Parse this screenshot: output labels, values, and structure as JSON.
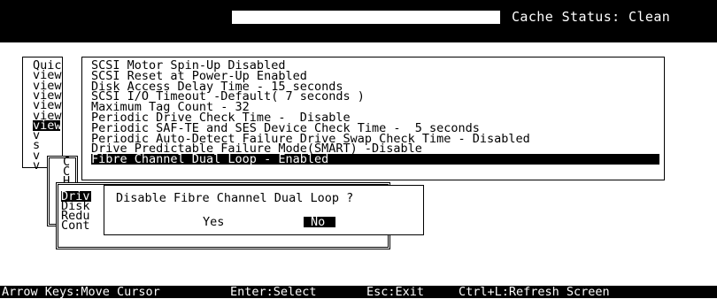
{
  "header": {
    "cache_status": "Cache Status: Clean"
  },
  "main_menu": {
    "items": [
      {
        "label": "Quic",
        "selected": false
      },
      {
        "label": "view",
        "selected": false
      },
      {
        "label": "view",
        "selected": false
      },
      {
        "label": "view",
        "selected": false
      },
      {
        "label": "view",
        "selected": false
      },
      {
        "label": "view",
        "selected": false
      },
      {
        "label": "view",
        "selected": true
      },
      {
        "label": "v",
        "selected": false
      },
      {
        "label": "s",
        "selected": false
      },
      {
        "label": "v",
        "selected": false
      },
      {
        "label": "v",
        "selected": false
      }
    ]
  },
  "submenu_level2": {
    "items": [
      "C",
      "C",
      "H"
    ]
  },
  "submenu_level3": {
    "items": [
      {
        "label": "Driv",
        "selected": true
      },
      {
        "label": "Disk",
        "selected": false
      },
      {
        "label": "Redu",
        "selected": false
      },
      {
        "label": "Cont",
        "selected": false
      }
    ]
  },
  "options_list": {
    "items": [
      {
        "label": "SCSI Motor Spin-Up Disabled",
        "selected": false
      },
      {
        "label": "SCSI Reset at Power-Up Enabled",
        "selected": false
      },
      {
        "label": "Disk Access Delay Time - 15 seconds",
        "selected": false
      },
      {
        "label": "SCSI I/O Timeout -Default( 7 seconds )",
        "selected": false
      },
      {
        "label": "Maximum Tag Count - 32",
        "selected": false
      },
      {
        "label": "Periodic Drive Check Time -  Disable",
        "selected": false
      },
      {
        "label": "Periodic SAF-TE and SES Device Check Time -  5 seconds",
        "selected": false
      },
      {
        "label": "Periodic Auto-Detect Failure Drive Swap Check Time - Disabled",
        "selected": false
      },
      {
        "label": "Drive Predictable Failure Mode(SMART) -Disable",
        "selected": false
      },
      {
        "label": "Fibre Channel Dual Loop - Enabled",
        "selected": true
      }
    ]
  },
  "dialog": {
    "question": "Disable Fibre Channel Dual Loop ?",
    "yes_label": "Yes",
    "no_label": "No"
  },
  "statusbar": {
    "arrows": "Arrow Keys:Move Cursor",
    "enter": "Enter:Select",
    "esc": "Esc:Exit",
    "ctrl_l": "Ctrl+L:Refresh Screen"
  }
}
